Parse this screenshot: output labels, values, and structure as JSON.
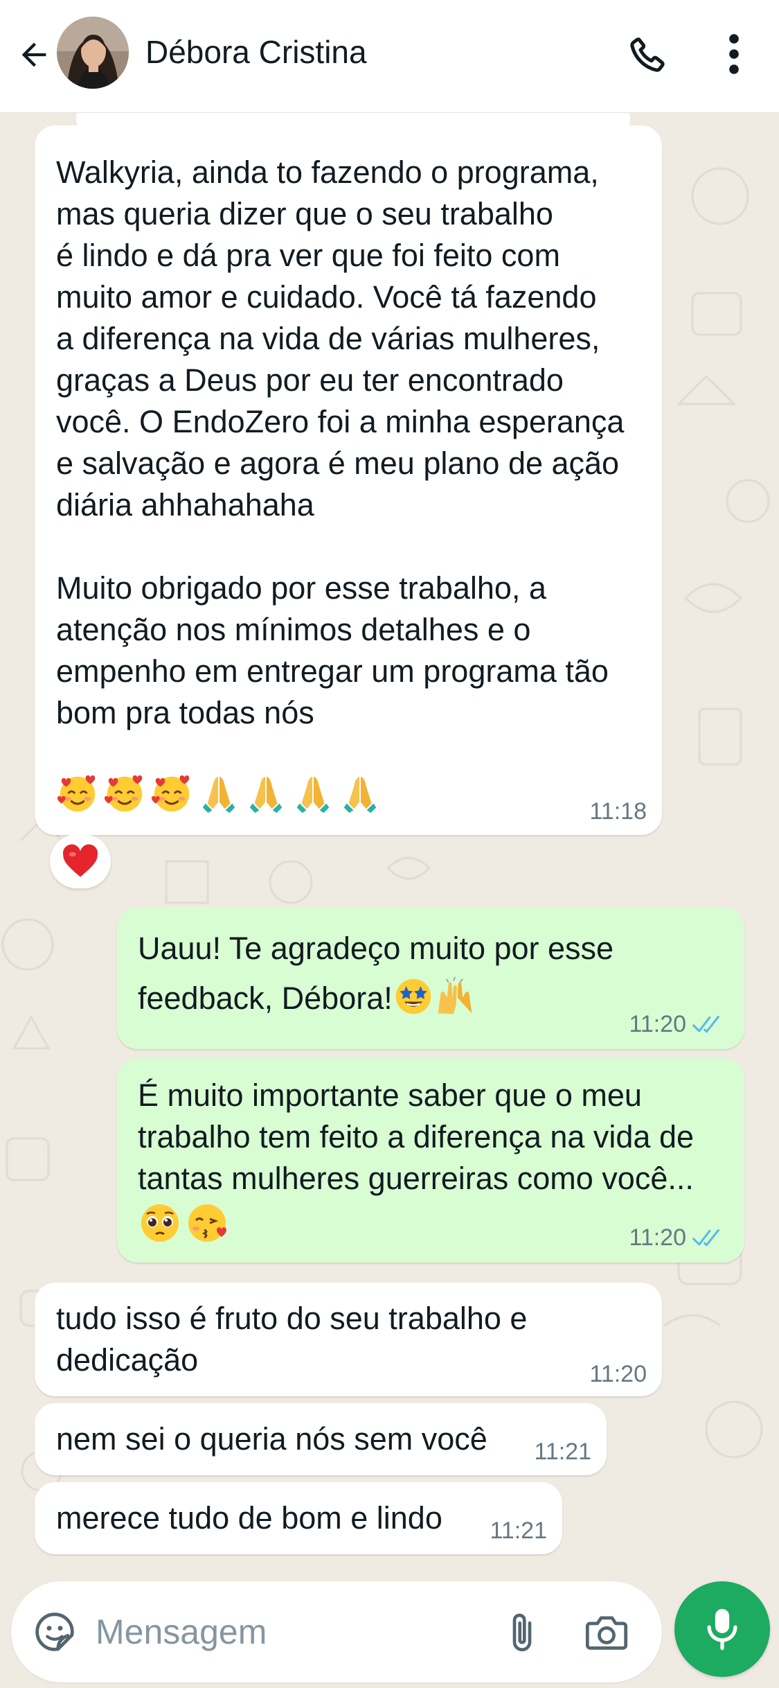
{
  "header": {
    "contact_name": "Débora Cristina",
    "back_icon": "arrow-left-icon",
    "call_icon": "phone-icon",
    "menu_icon": "more-vertical-icon"
  },
  "colors": {
    "header_bg": "#ffffff",
    "chat_bg": "#efeae2",
    "incoming_bubble": "#ffffff",
    "outgoing_bubble": "#d9fdd3",
    "read_ticks": "#53bdeb",
    "mic_button": "#1daa61",
    "time_text": "#667781"
  },
  "messages": [
    {
      "direction": "in",
      "text": "Walkyria, ainda to fazendo o programa,\nmas queria dizer que o seu trabalho\né lindo e dá pra ver que foi feito com\nmuito amor e cuidado. Você tá fazendo\na diferença na vida de várias mulheres,\ngraças a Deus por eu ter encontrado\nvocê. O EndoZero foi a minha esperança\ne salvação e agora é meu plano de ação\ndiária ahhahahaha\n\nMuito obrigado por esse trabalho, a\natenção nos mínimos detalhes e o\nempenho em entregar um programa tão\nbom pra todas nós",
      "emojis": [
        "smiling-face-with-hearts",
        "smiling-face-with-hearts",
        "smiling-face-with-hearts",
        "folded-hands",
        "folded-hands",
        "folded-hands",
        "folded-hands"
      ],
      "time": "11:18",
      "reaction": "red-heart"
    },
    {
      "direction": "out",
      "text": "Uauu! Te agradeço muito por esse\nfeedback, Débora!",
      "emojis": [
        "star-struck",
        "raising-hands"
      ],
      "time": "11:20",
      "status": "read"
    },
    {
      "direction": "out",
      "text": "É muito importante saber que o meu\ntrabalho tem feito a diferença na vida de\ntantas mulheres guerreiras como você...",
      "emojis": [
        "pleading-face",
        "face-blowing-kiss"
      ],
      "time": "11:20",
      "status": "read"
    },
    {
      "direction": "in",
      "text": "tudo isso é fruto do seu trabalho e\ndedicação",
      "time": "11:20"
    },
    {
      "direction": "in",
      "text": "nem sei o queria nós sem você",
      "time": "11:21"
    },
    {
      "direction": "in",
      "text": "merece tudo de bom e lindo",
      "time": "11:21"
    }
  ],
  "composer": {
    "placeholder": "Mensagem",
    "sticker_icon": "sticker-icon",
    "attach_icon": "paperclip-icon",
    "camera_icon": "camera-icon",
    "mic_icon": "microphone-icon"
  }
}
